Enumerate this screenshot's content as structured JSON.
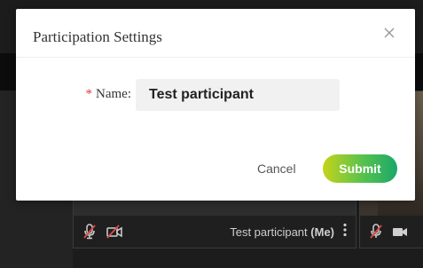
{
  "dialog": {
    "title": "Participation Settings",
    "close_icon": "close-icon",
    "name_label": "Name:",
    "required_marker": "*",
    "name_value": "Test participant",
    "cancel_label": "Cancel",
    "submit_label": "Submit"
  },
  "background": {
    "tile_name": "Test participant",
    "tile_me": "(Me)",
    "icons": [
      "mic-muted-icon",
      "camera-off-icon",
      "more-vertical-icon"
    ]
  },
  "colors": {
    "submit_gradient_start": "#c6d31a",
    "submit_gradient_end": "#19a86b",
    "required": "#e03b3b"
  }
}
